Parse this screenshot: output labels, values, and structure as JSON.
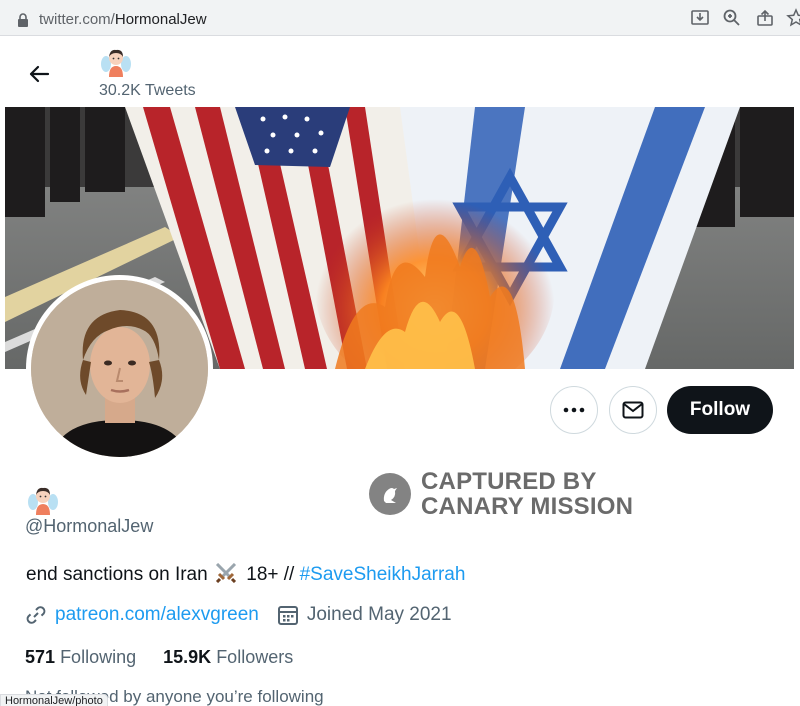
{
  "browser": {
    "url_domain": "twitter.com/",
    "url_path": "HormonalJew",
    "status_url": "HormonalJew/photo"
  },
  "header": {
    "tweet_count": "30.2K Tweets",
    "back_icon": "arrow-left-icon",
    "display_name_icon": "fairy-emoji-icon"
  },
  "actions": {
    "more_icon": "more-dots-icon",
    "message_icon": "envelope-icon",
    "follow_label": "Follow"
  },
  "watermark": {
    "line1": "CAPTURED BY",
    "line2": "CANARY MISSION"
  },
  "profile": {
    "handle": "@HormonalJew",
    "bio_text": "end sanctions on Iran",
    "bio_middle": "18+ //",
    "bio_hashtag": "#SaveSheikhJarrah",
    "website": "patreon.com/alexvgreen",
    "joined": "Joined May 2021",
    "following_count": "571",
    "following_label": "Following",
    "followers_count": "15.9K",
    "followers_label": "Followers",
    "not_followed_note": "Not followed by anyone you’re following"
  },
  "colors": {
    "accent": "#1d9bf0",
    "text": "#0f1419",
    "secondary": "#536471",
    "follow_bg": "#0f1419"
  }
}
